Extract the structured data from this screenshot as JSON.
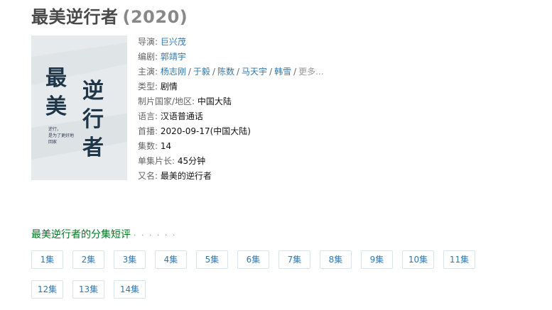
{
  "title": {
    "name": "最美逆行者",
    "year": "(2020)"
  },
  "poster": {
    "big_text": [
      "最",
      "美",
      "逆",
      "行",
      "者"
    ],
    "small_text": [
      "逆行，",
      "是为了更好地",
      "回家"
    ]
  },
  "info": {
    "director": {
      "label": "导演: ",
      "value": "巨兴茂"
    },
    "writer": {
      "label": "编剧: ",
      "value": "郭靖宇"
    },
    "cast": {
      "label": "主演: ",
      "actors": [
        "杨志刚",
        "于毅",
        "陈数",
        "马天宇",
        "韩雪"
      ],
      "separator": "/",
      "more": "更多..."
    },
    "genre": {
      "label": "类型: ",
      "value": "剧情"
    },
    "country": {
      "label": "制片国家/地区: ",
      "value": "中国大陆"
    },
    "language": {
      "label": "语言: ",
      "value": "汉语普通话"
    },
    "premiere": {
      "label": "首播: ",
      "value": "2020-09-17(中国大陆)"
    },
    "episodes": {
      "label": "集数: ",
      "value": "14"
    },
    "duration": {
      "label": "单集片长: ",
      "value": "45分钟"
    },
    "aka": {
      "label": "又名: ",
      "value": "最美的逆行者"
    }
  },
  "reviews": {
    "title": "最美逆行者的分集短评",
    "dots": "· · · · · ·"
  },
  "episode_buttons": [
    "1集",
    "2集",
    "3集",
    "4集",
    "5集",
    "6集",
    "7集",
    "8集",
    "9集",
    "10集",
    "11集",
    "12集",
    "13集",
    "14集"
  ]
}
